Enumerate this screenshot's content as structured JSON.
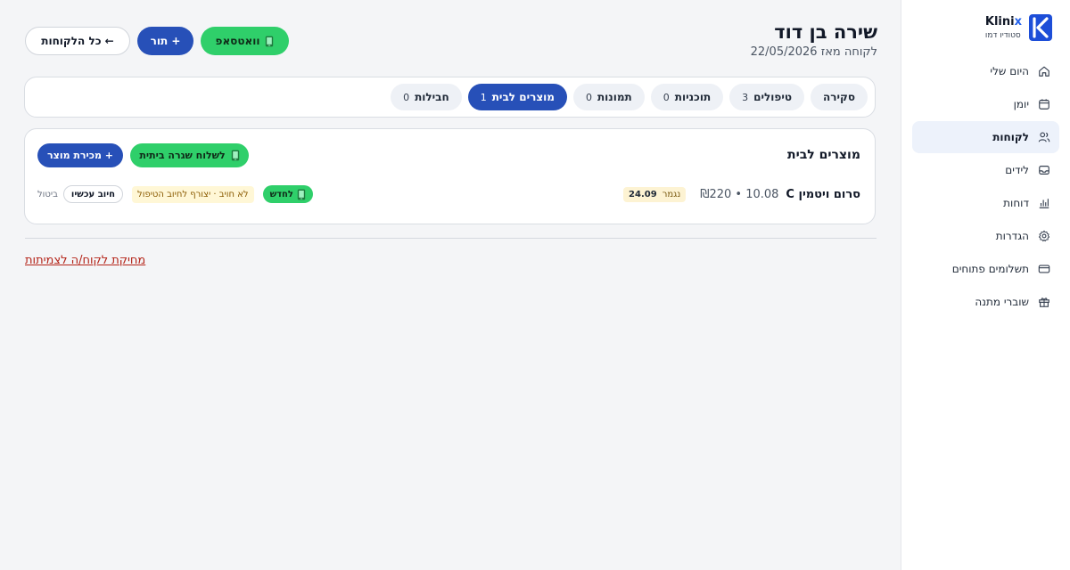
{
  "sidebar": {
    "brand_name": "Klini",
    "brand_name_accent": "x",
    "studio": "סטודיו דמו",
    "items": [
      {
        "label": "היום שלי",
        "icon": "home-icon"
      },
      {
        "label": "יומן",
        "icon": "calendar-icon"
      },
      {
        "label": "לקוחות",
        "icon": "users-icon",
        "active": true
      },
      {
        "label": "לידים",
        "icon": "inbox-icon"
      },
      {
        "label": "דוחות",
        "icon": "bar-chart-icon"
      },
      {
        "label": "הגדרות",
        "icon": "gear-icon"
      },
      {
        "label": "תשלומים פתוחים",
        "icon": "credit-card-icon"
      },
      {
        "label": "שוברי מתנה",
        "icon": "gift-icon"
      }
    ]
  },
  "header": {
    "client_name": "שירה בן דוד",
    "client_since": "לקוחה מאז 22/05/2026",
    "whatsapp_label": "וואטסאפ",
    "appointment_label": "+ תור",
    "all_clients_label": "← כל הלקוחות"
  },
  "tabs": [
    {
      "label": "סקירה",
      "count": ""
    },
    {
      "label": "טיפולים",
      "count": "3"
    },
    {
      "label": "תוכניות",
      "count": "0"
    },
    {
      "label": "תמונות",
      "count": "0"
    },
    {
      "label": "מוצרים לבית",
      "count": "1",
      "active": true
    },
    {
      "label": "חבילות",
      "count": "0"
    }
  ],
  "products": {
    "title": "מוצרים לבית",
    "send_routine_label": "לשלוח שגרה ביתית",
    "sell_product_label": "+ מכירת מוצר",
    "rows": [
      {
        "name": "סרום ויטמין C",
        "price": "₪220 • 10.08",
        "ends_label": "נגמר",
        "ends_date": "24.09",
        "renew_label": "לחדש",
        "charge_note": "לא חויב · יצורף לחיוב הטיפול",
        "charge_now_label": "חיוב עכשיו",
        "cancel_label": "ביטול"
      }
    ]
  },
  "delete_link": "מחיקת לקוח/ה לצמיתות",
  "colors": {
    "primary": "#2750b8",
    "whatsapp": "#2fcf6a",
    "danger": "#b42318",
    "active_nav_bg": "#edf2fb"
  }
}
